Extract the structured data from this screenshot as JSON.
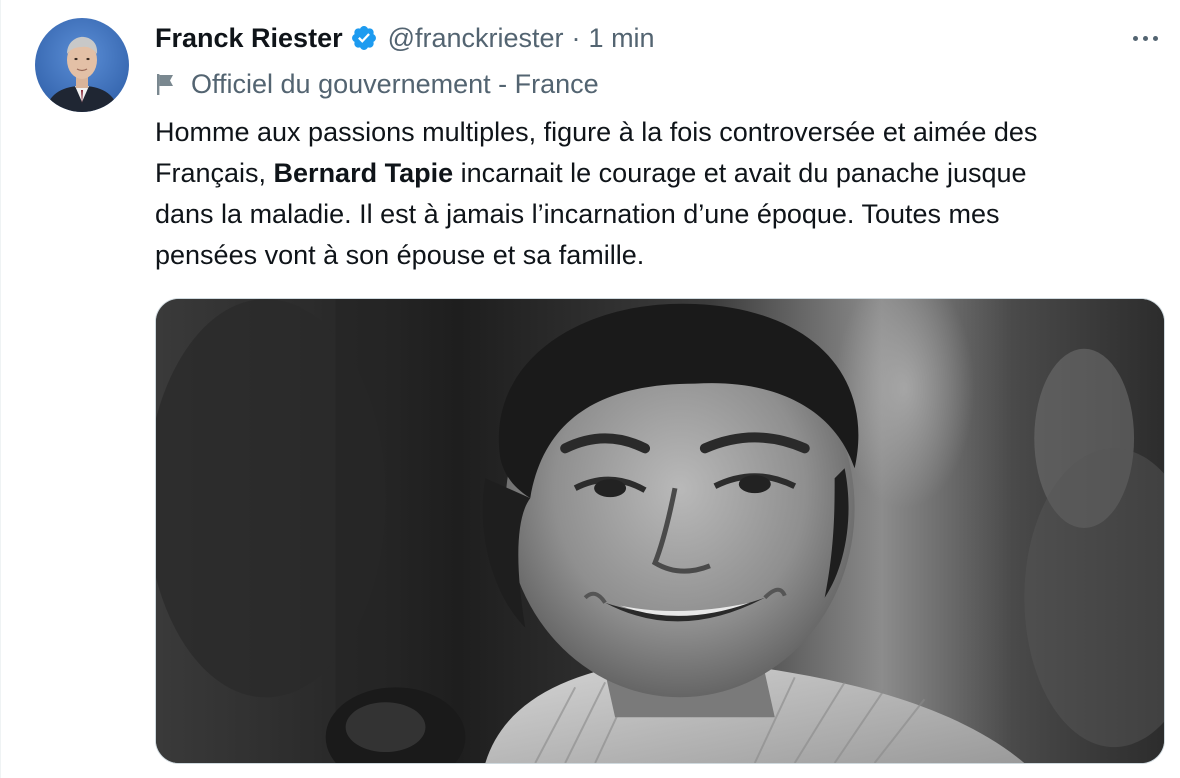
{
  "author": {
    "name": "Franck Riester",
    "handle": "@franckriester",
    "separator": "·",
    "time": "1 min",
    "verified": true,
    "avatar_icon": "profile-photo"
  },
  "label": {
    "icon": "flag-icon",
    "text": "Officiel du gouvernement - France"
  },
  "more_icon": "more-options-icon",
  "text": {
    "line1": "Homme aux passions multiples, figure à la fois controversée et aimée des",
    "line2_pre": "Français, ",
    "line2_bold": "Bernard Tapie",
    "line2_post": " incarnait le courage et avait du panache jusque",
    "line3": "dans la maladie. Il est à jamais l’incarnation d’une époque. Toutes mes",
    "line4": "pensées vont à son épouse et sa famille."
  },
  "media": {
    "type": "photo",
    "style": "black-and-white portrait"
  },
  "colors": {
    "text_primary": "#0f1419",
    "text_secondary": "#536471",
    "verified_blue": "#1d9bf0",
    "border": "#cfd9de"
  }
}
